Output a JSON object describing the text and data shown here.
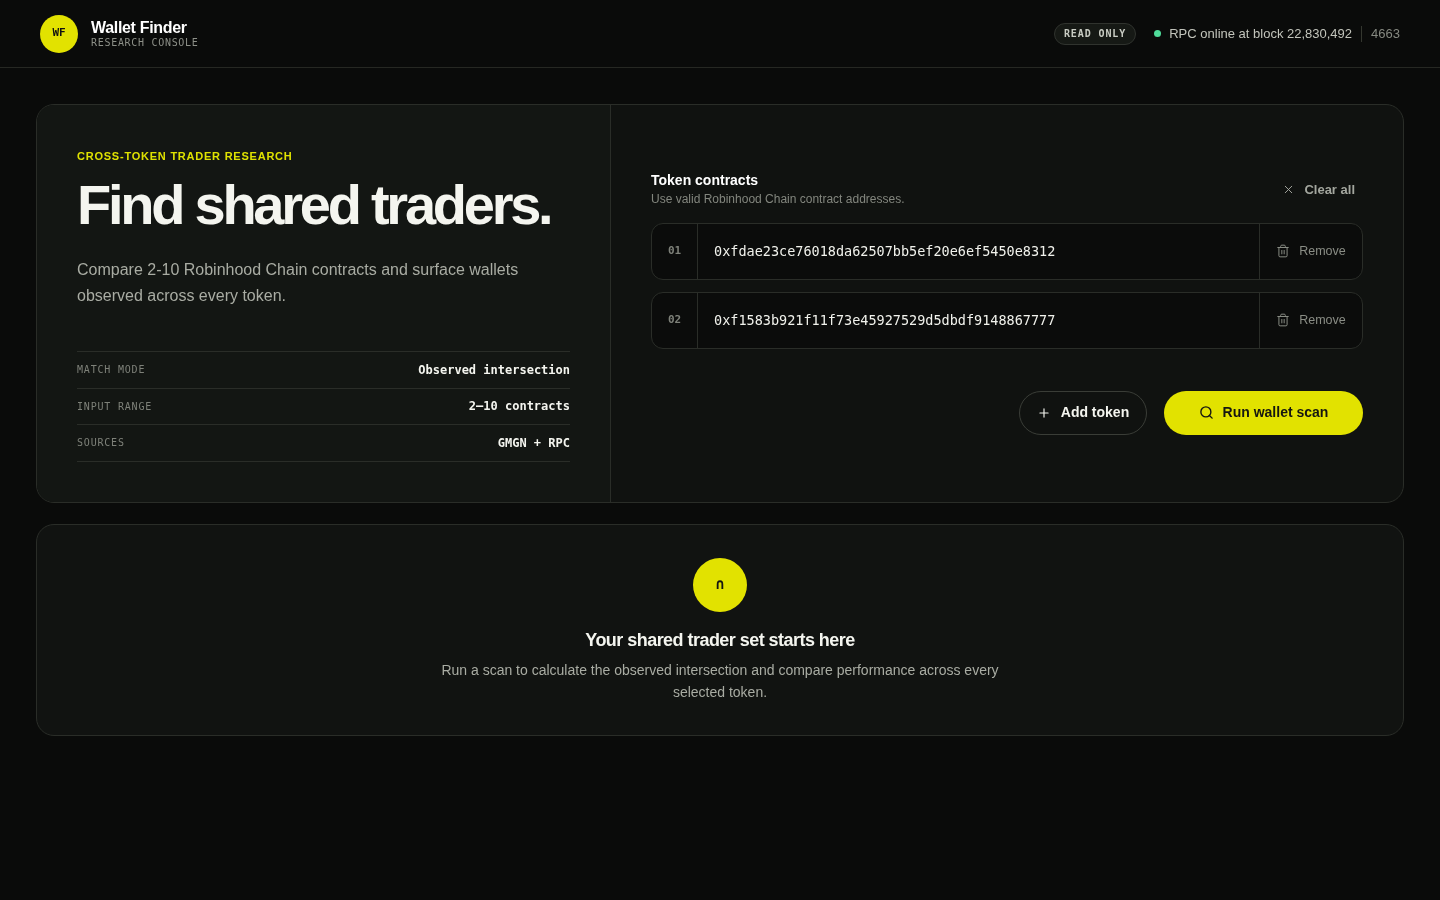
{
  "header": {
    "logo_initials": "WF",
    "title": "Wallet Finder",
    "subtitle": "RESEARCH CONSOLE",
    "badge": "READ ONLY",
    "status": {
      "online": true,
      "text": "RPC online at block 22,830,492"
    },
    "counter": "4663"
  },
  "hero": {
    "eyebrow": "CROSS-TOKEN TRADER RESEARCH",
    "title": "Find shared traders.",
    "description": "Compare 2-10 Robinhood Chain contracts and surface wallets observed across every token.",
    "facts": [
      {
        "label": "MATCH MODE",
        "value": "Observed intersection"
      },
      {
        "label": "INPUT RANGE",
        "value": "2–10 contracts"
      },
      {
        "label": "SOURCES",
        "value": "GMGN + RPC"
      }
    ]
  },
  "token_panel": {
    "title": "Token contracts",
    "subtitle": "Use valid Robinhood Chain contract addresses.",
    "clear_button": "Clear all",
    "tokens": [
      {
        "index": "01",
        "address": "0xfdae23ce76018da62507bb5ef20e6ef5450e8312",
        "remove_label": "Remove"
      },
      {
        "index": "02",
        "address": "0xf1583b921f11f73e45927529d5dbdf9148867777",
        "remove_label": "Remove"
      }
    ],
    "add_button": "Add token",
    "run_button": "Run wallet scan"
  },
  "empty_state": {
    "symbol": "∩",
    "title": "Your shared trader set starts here",
    "description": "Run a scan to calculate the observed intersection and compare performance across every selected token."
  }
}
